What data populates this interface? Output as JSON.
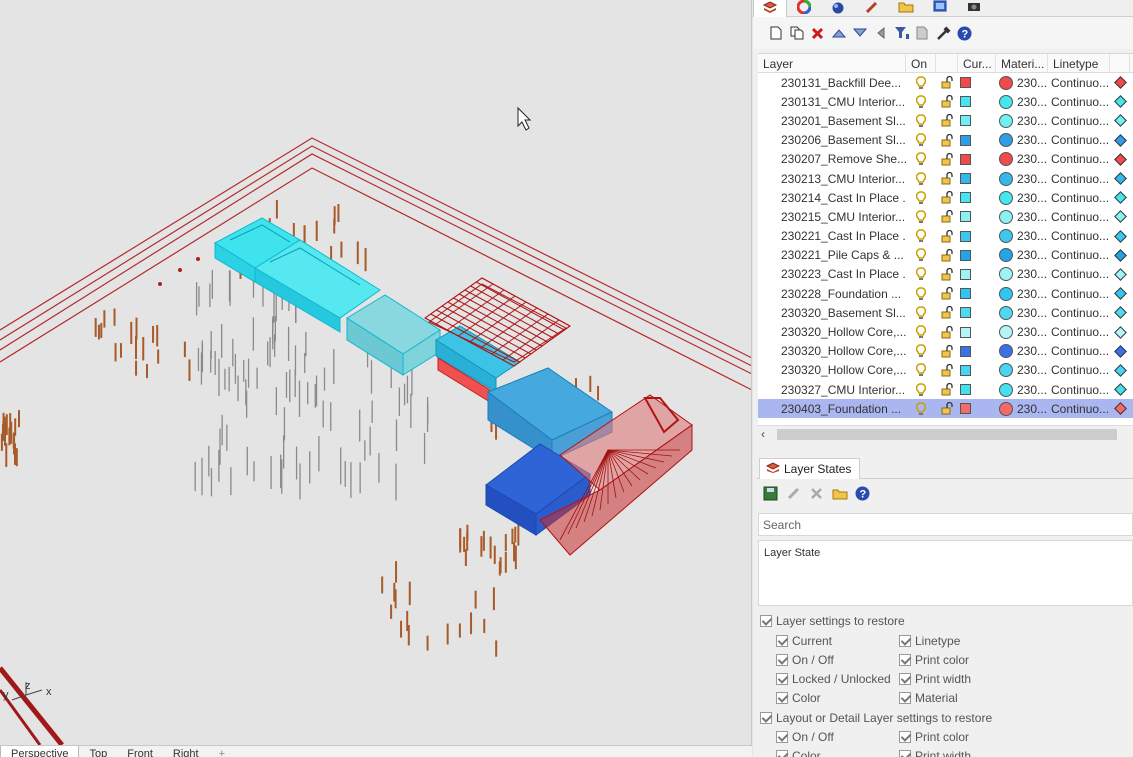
{
  "viewport": {
    "tabs": [
      "Perspective",
      "Top",
      "Front",
      "Right",
      "+"
    ],
    "active_tab": "Perspective",
    "axis_labels": {
      "x": "x",
      "y": "y",
      "z": "z"
    }
  },
  "panel": {
    "tabs": [
      "layers-icon",
      "color-wheel-icon",
      "render-sphere-icon",
      "pen-icon",
      "folder-icon",
      "display-icon",
      "camera-icon"
    ],
    "toolbar": [
      "new-layer-icon",
      "new-sublayer-icon",
      "delete-icon",
      "move-up-icon",
      "move-down-icon",
      "move-to-parent-icon",
      "filter-icon",
      "copy-icon",
      "tools-icon",
      "help-icon"
    ],
    "layers_header": {
      "name": "Layer",
      "on": "On",
      "current": "Cur...",
      "material": "Materi...",
      "linetype": "Linetype"
    },
    "layers": [
      {
        "name": "230131_Backfill Dee...",
        "material": "230...",
        "linetype": "Continuo...",
        "color": "#f04a4a"
      },
      {
        "name": "230131_CMU Interior...",
        "material": "230...",
        "linetype": "Continuo...",
        "color": "#45e6ee"
      },
      {
        "name": "230201_Basement Sl...",
        "material": "230...",
        "linetype": "Continuo...",
        "color": "#6ff0f2"
      },
      {
        "name": "230206_Basement Sl...",
        "material": "230...",
        "linetype": "Continuo...",
        "color": "#2e9ee8"
      },
      {
        "name": "230207_Remove She...",
        "material": "230...",
        "linetype": "Continuo...",
        "color": "#f04a4a"
      },
      {
        "name": "230213_CMU Interior...",
        "material": "230...",
        "linetype": "Continuo...",
        "color": "#35b8ec"
      },
      {
        "name": "230214_Cast In Place ...",
        "material": "230...",
        "linetype": "Continuo...",
        "color": "#45e6ee"
      },
      {
        "name": "230215_CMU Interior...",
        "material": "230...",
        "linetype": "Continuo...",
        "color": "#8af1f3"
      },
      {
        "name": "230221_Cast In Place ...",
        "material": "230...",
        "linetype": "Continuo...",
        "color": "#3cc8ee"
      },
      {
        "name": "230221_Pile Caps & ...",
        "material": "230...",
        "linetype": "Continuo...",
        "color": "#22a4e6"
      },
      {
        "name": "230223_Cast In Place ...",
        "material": "230...",
        "linetype": "Continuo...",
        "color": "#9ff3f4"
      },
      {
        "name": "230228_Foundation ...",
        "material": "230...",
        "linetype": "Continuo...",
        "color": "#30c6f0"
      },
      {
        "name": "230320_Basement Sl...",
        "material": "230...",
        "linetype": "Continuo...",
        "color": "#4ed9f1"
      },
      {
        "name": "230320_Hollow Core,...",
        "material": "230...",
        "linetype": "Continuo...",
        "color": "#b4f6f6"
      },
      {
        "name": "230320_Hollow Core,...",
        "material": "230...",
        "linetype": "Continuo...",
        "color": "#3a72e6"
      },
      {
        "name": "230320_Hollow Core,...",
        "material": "230...",
        "linetype": "Continuo...",
        "color": "#4ad4f0"
      },
      {
        "name": "230327_CMU Interior...",
        "material": "230...",
        "linetype": "Continuo...",
        "color": "#45e0ef"
      },
      {
        "name": "230403_Foundation ...",
        "material": "230...",
        "linetype": "Continuo...",
        "color": "#f26a6a",
        "selected": true
      }
    ],
    "layer_states": {
      "tab_label": "Layer States",
      "toolbar": [
        "save-icon",
        "edit-icon",
        "delete-icon",
        "open-folder-icon",
        "help-icon"
      ],
      "search_placeholder": "Search",
      "list_header": "Layer State",
      "settings_label": "Layer settings to restore",
      "settings_left": [
        "Current",
        "On / Off",
        "Locked / Unlocked",
        "Color"
      ],
      "settings_right": [
        "Linetype",
        "Print color",
        "Print width",
        "Material"
      ],
      "detail_label": "Layout or Detail Layer settings to restore",
      "detail_left": [
        "On / Off",
        "Color"
      ],
      "detail_right": [
        "Print color",
        "Print width"
      ]
    }
  }
}
